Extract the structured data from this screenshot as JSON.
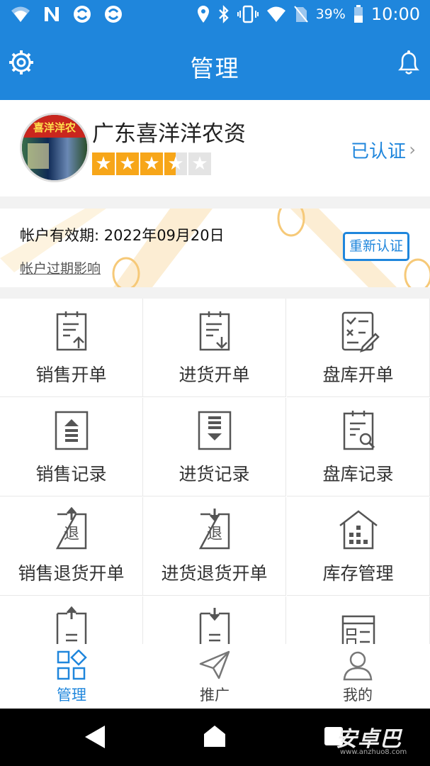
{
  "status": {
    "time": "10:00",
    "battery": "39%"
  },
  "header": {
    "title": "管理"
  },
  "profile": {
    "shop_name": "广东喜洋洋农资",
    "avatar_sign": "喜洋洋农",
    "rating": 3.5,
    "rating_max": 5,
    "verified_label": "已认证"
  },
  "account": {
    "validity": "帐户有效期: 2022年09月20日",
    "expiry_link": "帐户过期影响",
    "reauth_button": "重新认证"
  },
  "grid": {
    "items": [
      {
        "label": "销售开单",
        "icon": "doc-upload-icon"
      },
      {
        "label": "进货开单",
        "icon": "doc-download-icon"
      },
      {
        "label": "盘库开单",
        "icon": "checklist-edit-icon"
      },
      {
        "label": "销售记录",
        "icon": "doc-arrow-up-icon"
      },
      {
        "label": "进货记录",
        "icon": "doc-arrow-down-icon"
      },
      {
        "label": "盘库记录",
        "icon": "doc-search-icon"
      },
      {
        "label": "销售退货开单",
        "icon": "return-up-icon",
        "glyph": "退"
      },
      {
        "label": "进货退货开单",
        "icon": "return-down-icon",
        "glyph": "退"
      },
      {
        "label": "库存管理",
        "icon": "warehouse-icon"
      },
      {
        "label": "",
        "icon": "doc-list-up-icon"
      },
      {
        "label": "",
        "icon": "doc-list-down-icon"
      },
      {
        "label": "",
        "icon": "form-icon"
      }
    ]
  },
  "tabs": [
    {
      "label": "管理",
      "icon": "grid-diamond-icon",
      "active": true
    },
    {
      "label": "推广",
      "icon": "paper-plane-icon",
      "active": false
    },
    {
      "label": "我的",
      "icon": "user-icon",
      "active": false
    }
  ],
  "watermark": {
    "brand": "安卓巴",
    "url": "www.anzhuo8.com"
  },
  "colors": {
    "primary": "#1f86dc",
    "star": "#f7a619"
  }
}
